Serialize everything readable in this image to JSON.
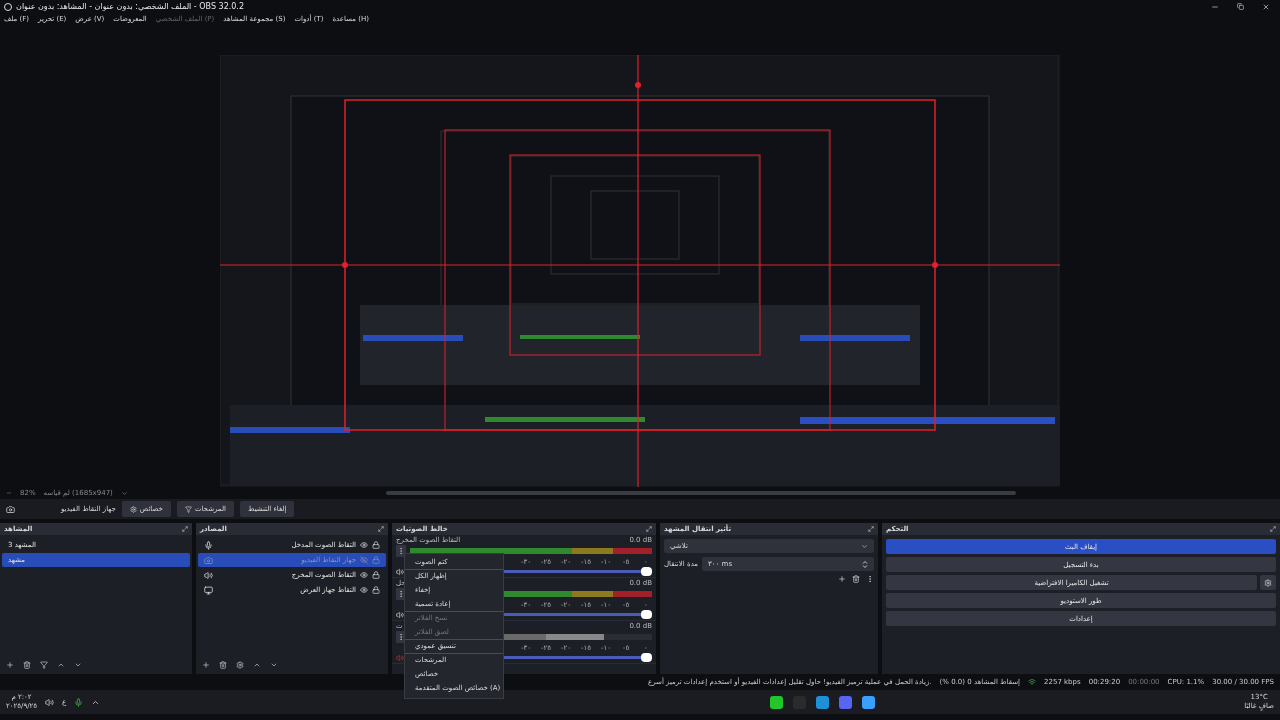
{
  "window": {
    "title": "الملف الشخصي: بدون عنوان - المشاهد: بدون عنوان - OBS 32.0.2"
  },
  "menu": [
    {
      "label": "مساعدة (H)",
      "disabled": false
    },
    {
      "label": "أدوات (T)",
      "disabled": false
    },
    {
      "label": "مجموعة المشاهد (S)",
      "disabled": false
    },
    {
      "label": "الملف الشخصي (P)",
      "disabled": true
    },
    {
      "label": "المعروضات",
      "disabled": false
    },
    {
      "label": "عرض (V)",
      "disabled": false
    },
    {
      "label": "تحرير (E)",
      "disabled": false
    },
    {
      "label": "ملف (F)",
      "disabled": false
    }
  ],
  "preview": {
    "zoom": "82%",
    "size": "لم قياسه (1685x947)"
  },
  "source_toolbar": {
    "source": "جهاز التقاط الفيديو",
    "buttons": [
      {
        "label": "إلغاء التنشيط",
        "kind": "plain"
      },
      {
        "label": "المرشحات",
        "kind": "filters"
      },
      {
        "label": "خصائص",
        "kind": "properties"
      }
    ]
  },
  "scenes": {
    "title": "المشاهد",
    "items": [
      {
        "label": "المشهد 3",
        "selected": false
      },
      {
        "label": "مشهد",
        "selected": true
      }
    ]
  },
  "sources": {
    "title": "المصادر",
    "items": [
      {
        "label": "التقاط الصوت المدخل",
        "kind": "mic",
        "visible": true,
        "selected": false
      },
      {
        "label": "جهاز التقاط الفيديو",
        "kind": "camera",
        "visible": false,
        "selected": true
      },
      {
        "label": "التقاط الصوت المخرج",
        "kind": "speaker",
        "visible": true,
        "selected": false
      },
      {
        "label": "التقاط جهاز العرض",
        "kind": "monitor",
        "visible": true,
        "selected": false
      }
    ]
  },
  "mixer": {
    "title": "خالط الصوتيات",
    "channels": [
      {
        "name": "التقاط الصوت المخرج",
        "reading": "0.0 dB",
        "muted": false,
        "level": 1,
        "ticks": [
          "٠",
          "-٥",
          "-١٠",
          "-١٥",
          "-٢٠",
          "-٢٥",
          "-٣٠"
        ],
        "volume": {
          "level": 1
        }
      },
      {
        "name": "حل",
        "reading": "0.0 dB",
        "muted": false,
        "level": 1,
        "ticks": [
          "٠",
          "-٥",
          "-١٠",
          "-١٥",
          "-٢٠",
          "-٢٥",
          "-٣٠"
        ],
        "volume": {
          "level": 1
        }
      },
      {
        "name": "ت",
        "reading": "0.0 dB",
        "muted": true,
        "level": 0.8,
        "ticks": [
          "٠",
          "-٥",
          "-١٠",
          "-١٥",
          "-٢٠",
          "-٢٥",
          "-٣٠"
        ],
        "volume": {
          "level": 1
        }
      }
    ],
    "context_menu": [
      {
        "label": "كتم الصوت",
        "disabled": false,
        "separator_after": true
      },
      {
        "label": "إظهار الكل",
        "disabled": false,
        "separator_after": false
      },
      {
        "label": "إخفاء",
        "disabled": false,
        "separator_after": false
      },
      {
        "label": "إعادة تسمية",
        "disabled": false,
        "separator_after": true
      },
      {
        "label": "نسخ الفلاتر",
        "disabled": true,
        "separator_after": false
      },
      {
        "label": "لصق الفلاتر",
        "disabled": true,
        "separator_after": true
      },
      {
        "label": "تنسيق عمودي",
        "disabled": false,
        "separator_after": true
      },
      {
        "label": "المرشحات",
        "disabled": false,
        "separator_after": false
      },
      {
        "label": "خصائص",
        "disabled": false,
        "separator_after": false
      },
      {
        "label": "خصائص الصوت المتقدمة (A)",
        "disabled": false,
        "separator_after": false
      }
    ]
  },
  "transitions": {
    "title": "تأثير انتقال المشهد",
    "transition": "تلاشي",
    "duration_label": "مدة الانتقال",
    "duration": "٣٠٠ ms"
  },
  "controls": {
    "title": "التحكم",
    "buttons": [
      {
        "label": "إيقاف البث",
        "active": true,
        "settings": false
      },
      {
        "label": "بدء التسجيل",
        "active": false,
        "settings": false
      },
      {
        "label": "تشغيل الكاميرا الافتراضية",
        "active": false,
        "settings": true
      },
      {
        "label": "طور الاستوديو",
        "active": false,
        "settings": false
      },
      {
        "label": "إعدادات",
        "active": false,
        "settings": false
      }
    ]
  },
  "status_bar": {
    "fps": "30.00 / 30.00 FPS",
    "cpu": "CPU: 1.1%",
    "record_time": "00:00:00",
    "stream_time": "00:29:20",
    "bitrate": "2257 kbps",
    "dropped": "إسقاط المشاهد 0 (0.0 %)",
    "warning": "زيادة الحمل في عملية ترميز الفيديو! حاول تقليل إعدادات الفيديو أو استخدم إعدادات ترميز أسرع."
  },
  "taskbar": {
    "time": "٢:٠٢ م",
    "date": "٢٠٢٥/٩/٢٥",
    "language": "ع",
    "temperature": "13°C",
    "weather": "صافٍ غالبًا"
  }
}
